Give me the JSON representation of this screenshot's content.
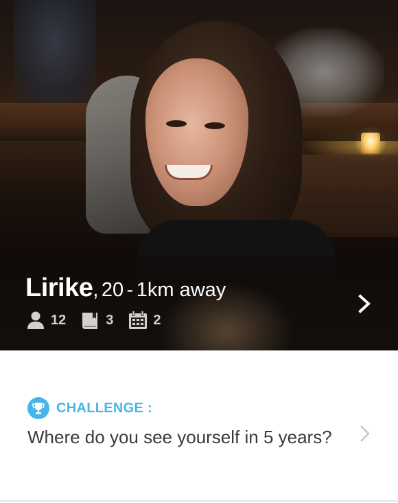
{
  "profile": {
    "name": "Lirike",
    "name_separator": ",",
    "age": "20",
    "distance_separator": "-",
    "distance": "1km away"
  },
  "stats": {
    "friends_count": "12",
    "friends_icon": "person-icon",
    "books_count": "3",
    "books_icon": "book-icon",
    "events_count": "2",
    "events_icon": "calendar-icon"
  },
  "challenge": {
    "label": "CHALLENGE :",
    "icon": "trophy-icon",
    "question": "Where do you see yourself in 5 years?"
  },
  "colors": {
    "accent": "#48b5e8",
    "question_text": "#3a3a3a",
    "stat_text": "#d4d0cc"
  }
}
